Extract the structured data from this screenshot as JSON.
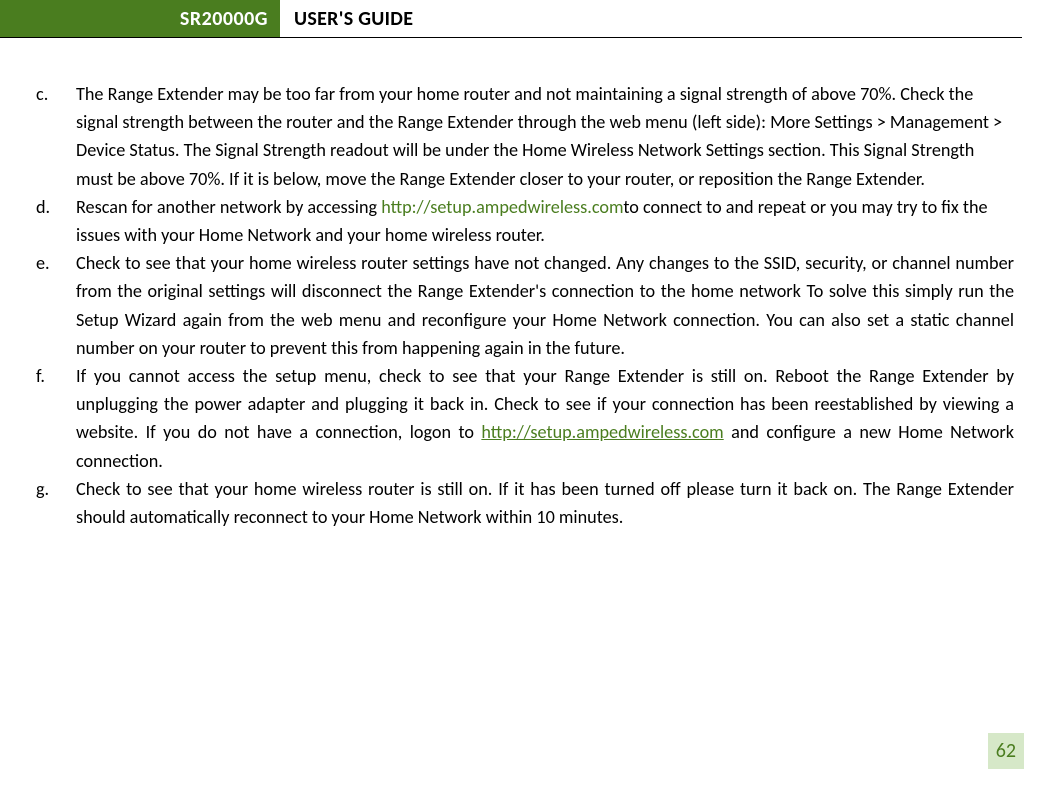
{
  "header": {
    "product": "SR20000G",
    "title": "USER'S GUIDE"
  },
  "items": {
    "c": {
      "marker": "c.",
      "text": "The Range Extender may be too far from your home router and not maintaining a signal strength of above 70%. Check the signal strength between the router and the Range Extender through the web menu (left side): More Settings > Management > Device Status. The Signal Strength readout will be under the Home Wireless Network Settings section. This Signal Strength must be above 70%. If it is below, move the Range Extender closer to your router, or reposition the Range Extender."
    },
    "d": {
      "marker": "d.",
      "pre": "Rescan for another network by accessing ",
      "link": "http://setup.ampedwireless.com",
      "post": "to connect to and repeat or you may try to fix the issues with your Home Network and your home wireless router."
    },
    "e": {
      "marker": "e.",
      "text": "Check to see that your home wireless router settings have not changed. Any changes to the SSID, security, or channel number from the original settings will disconnect the Range Extender's connection to the home network To solve this simply run the Setup Wizard again from the web menu and reconfigure your Home Network connection. You can also set a static channel number on your router to prevent this from happening again in the future."
    },
    "f": {
      "marker": "f.",
      "pre": "If you cannot access the setup menu, check to see that your Range Extender is still on. Reboot the Range Extender by unplugging the power adapter and plugging it back in. Check to see if your connection has been reestablished by viewing a website. If you do not have a connection, logon to ",
      "link": "http://setup.ampedwireless.com",
      "post": " and configure a new Home Network connection."
    },
    "g": {
      "marker": "g.",
      "text": "Check to see that your home wireless router is still on. If it has been turned off please turn it back on. The Range Extender should automatically reconnect to your Home Network within 10 minutes."
    }
  },
  "page_number": "62"
}
